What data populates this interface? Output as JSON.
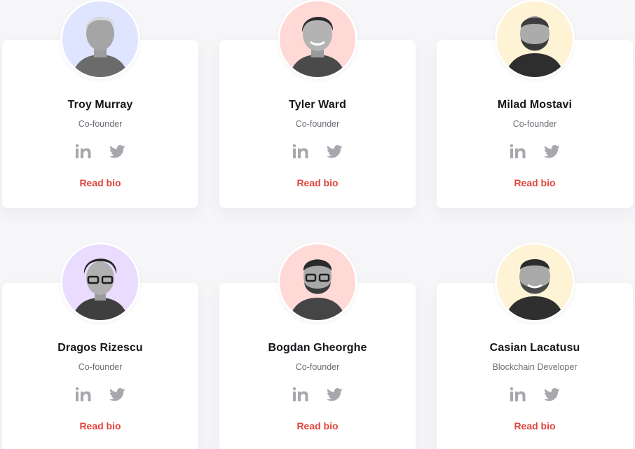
{
  "team": {
    "members": [
      {
        "name": "Troy Murray",
        "role": "Co-founder",
        "read_bio": "Read bio",
        "bg": "#dfe4ff"
      },
      {
        "name": "Tyler Ward",
        "role": "Co-founder",
        "read_bio": "Read bio",
        "bg": "#ffd9d6"
      },
      {
        "name": "Milad Mostavi",
        "role": "Co-founder",
        "read_bio": "Read bio",
        "bg": "#fff3d6"
      },
      {
        "name": "Dragos Rizescu",
        "role": "Co-founder",
        "read_bio": "Read bio",
        "bg": "#eadcff"
      },
      {
        "name": "Bogdan Gheorghe",
        "role": "Co-founder",
        "read_bio": "Read bio",
        "bg": "#ffd9d6"
      },
      {
        "name": "Casian Lacatusu",
        "role": "Blockchain Developer",
        "read_bio": "Read bio",
        "bg": "#fff3d6"
      }
    ],
    "icons": {
      "linkedin": "linkedin-icon",
      "twitter": "twitter-icon"
    },
    "colors": {
      "accent": "#e0443c",
      "icon": "#a6a8ad",
      "card": "#ffffff",
      "page_bg": "#f6f6f9"
    }
  }
}
